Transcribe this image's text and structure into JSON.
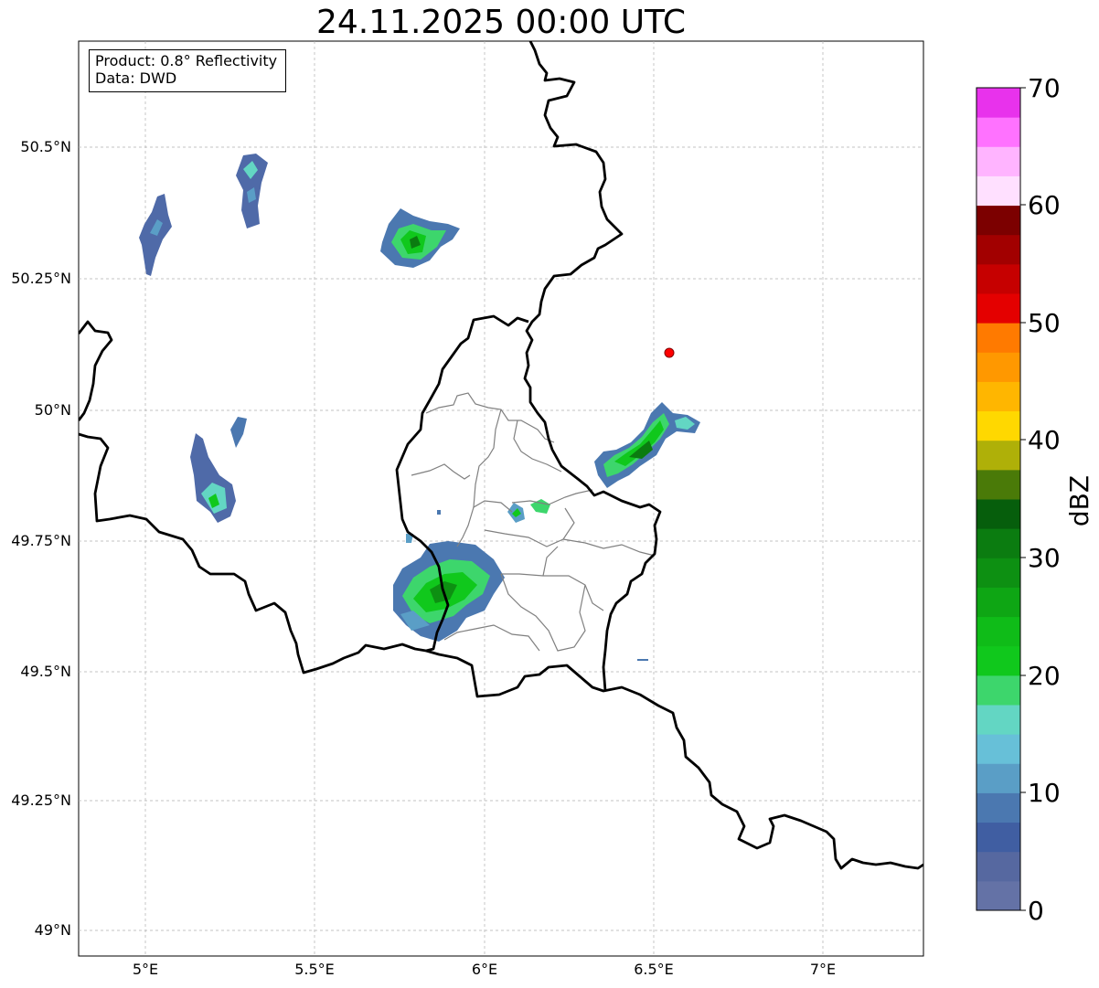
{
  "title": "24.11.2025 00:00 UTC",
  "info": {
    "product": "Product: 0.8° Reflectivity",
    "data": "Data: DWD"
  },
  "map": {
    "lat_ticks": [
      "50.5°N",
      "50.25°N",
      "50°N",
      "49.75°N",
      "49.5°N",
      "49.25°N",
      "49°N"
    ],
    "lon_ticks": [
      "5°E",
      "5.5°E",
      "6°E",
      "6.5°E",
      "7°E"
    ],
    "marker_color": "#ff0000",
    "border_color": "#000000",
    "admin_border_color": "#808080"
  },
  "colorbar": {
    "label": "dBZ",
    "ticks": [
      "0",
      "10",
      "20",
      "30",
      "40",
      "50",
      "60",
      "70"
    ],
    "colors": [
      "#6472a6",
      "#5668a0",
      "#405ea2",
      "#4b78b0",
      "#5a9ec6",
      "#67c0d8",
      "#63d6c3",
      "#3dd66c",
      "#10c81c",
      "#0fbc18",
      "#0ea614",
      "#0d9012",
      "#0b7c10",
      "#065e0c",
      "#4a7a08",
      "#afb008",
      "#ffd800",
      "#ffb600",
      "#ff9800",
      "#ff7a00",
      "#e40000",
      "#c60000",
      "#a20000",
      "#7c0000",
      "#ffe0ff",
      "#ffb4ff",
      "#ff72ff",
      "#e832ec"
    ]
  }
}
